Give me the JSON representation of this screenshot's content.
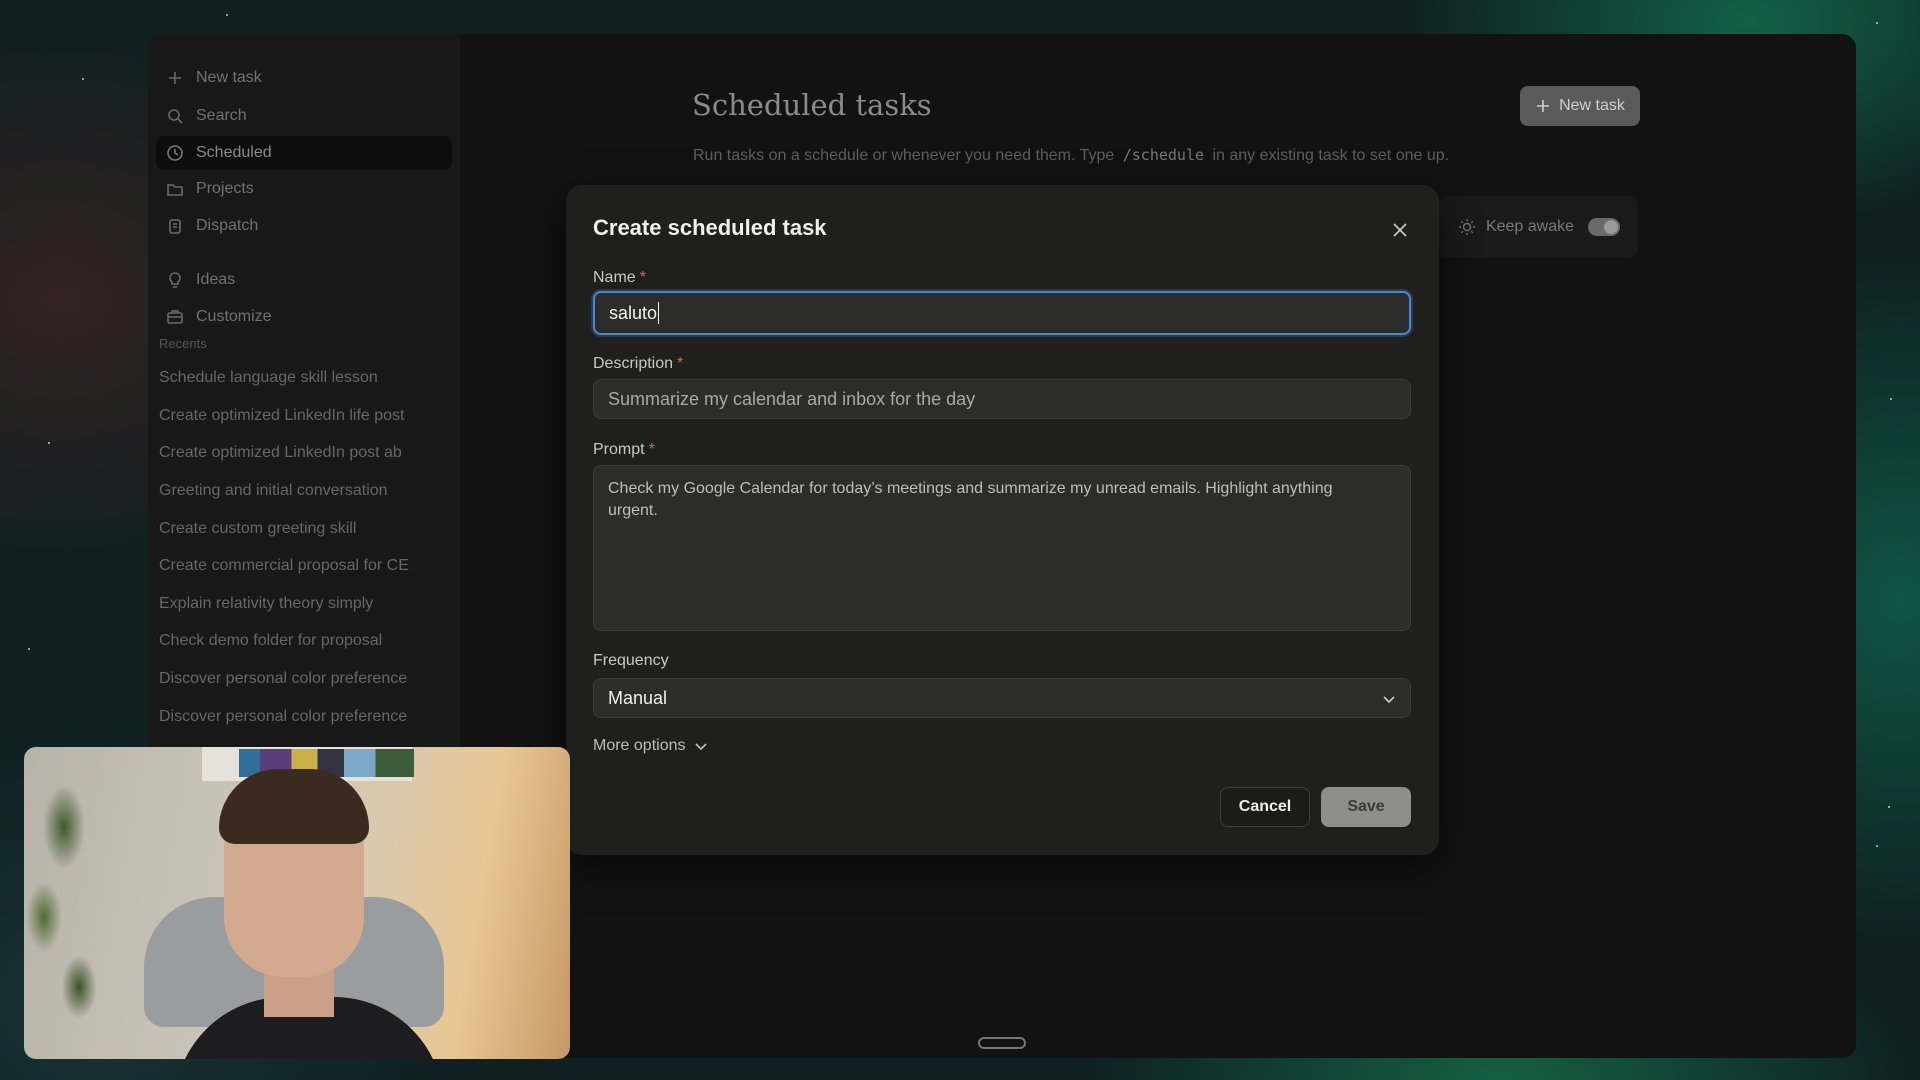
{
  "sidebar": {
    "nav": [
      {
        "label": "New task",
        "icon": "plus-icon"
      },
      {
        "label": "Search",
        "icon": "search-icon"
      },
      {
        "label": "Scheduled",
        "icon": "clock-icon",
        "active": true
      },
      {
        "label": "Projects",
        "icon": "folder-icon"
      },
      {
        "label": "Dispatch",
        "icon": "dispatch-icon"
      },
      {
        "label": "Ideas",
        "icon": "lightbulb-icon"
      },
      {
        "label": "Customize",
        "icon": "briefcase-icon"
      }
    ],
    "recents_label": "Recents",
    "recents": [
      "Schedule language skill lesson",
      "Create optimized LinkedIn life post",
      "Create optimized LinkedIn post ab",
      "Greeting and initial conversation",
      "Create custom greeting skill",
      "Create commercial proposal for CE",
      "Explain relativity theory simply",
      "Check demo folder for proposal",
      "Discover personal color preference",
      "Discover personal color preference"
    ]
  },
  "main": {
    "title": "Scheduled tasks",
    "subtitle_before": "Run tasks on a schedule or whenever you need them. Type",
    "subtitle_code": "/schedule",
    "subtitle_after": "in any existing task to set one up.",
    "new_task_label": "New task",
    "keep_awake_label": "Keep awake",
    "keep_awake_on": true
  },
  "modal": {
    "title": "Create scheduled task",
    "name_label": "Name",
    "name_value": "saluto",
    "description_label": "Description",
    "description_placeholder": "Summarize my calendar and inbox for the day",
    "prompt_label": "Prompt",
    "prompt_placeholder": "Check my Google Calendar for today’s meetings and summarize my unread emails. Highlight anything urgent.",
    "frequency_label": "Frequency",
    "frequency_value": "Manual",
    "more_options_label": "More options",
    "cancel_label": "Cancel",
    "save_label": "Save",
    "required_marker": "*"
  },
  "colors": {
    "accent_focus": "#4a86d8",
    "required": "#d06a5a",
    "modal_bg": "#1f1f1e",
    "window_bg": "#121212"
  }
}
